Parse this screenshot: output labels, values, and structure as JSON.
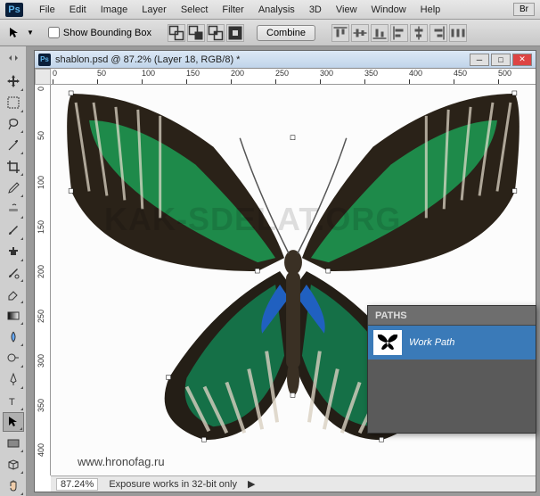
{
  "menubar": {
    "items": [
      "File",
      "Edit",
      "Image",
      "Layer",
      "Select",
      "Filter",
      "Analysis",
      "3D",
      "View",
      "Window",
      "Help"
    ],
    "br_label": "Br"
  },
  "optionsbar": {
    "show_bbox_label": "Show Bounding Box",
    "combine_label": "Combine"
  },
  "document": {
    "title": "shablon.psd @ 87.2% (Layer 18, RGB/8) *",
    "ruler_h": [
      "0",
      "50",
      "100",
      "150",
      "200",
      "250",
      "300",
      "350",
      "400",
      "450",
      "500"
    ],
    "ruler_v": [
      "0",
      "50",
      "100",
      "150",
      "200",
      "250",
      "300",
      "350",
      "400"
    ],
    "watermark": "KAK-SDELAT.ORG",
    "url": "www.hronofag.ru"
  },
  "statusbar": {
    "zoom": "87.24%",
    "info": "Exposure works in 32-bit only"
  },
  "paths_panel": {
    "title": "PATHS",
    "items": [
      {
        "name": "Work Path"
      }
    ]
  }
}
